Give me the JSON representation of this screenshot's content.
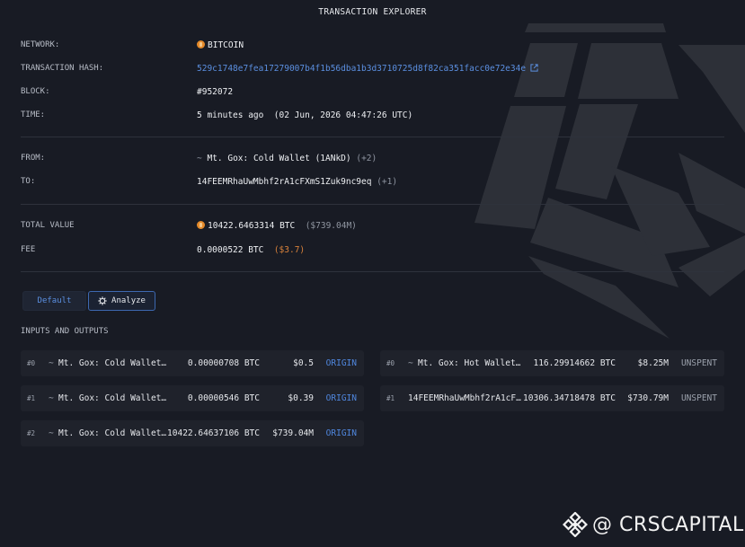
{
  "title": "TRANSACTION EXPLORER",
  "details": {
    "network_label": "NETWORK:",
    "network_value": "BITCOIN",
    "hash_label": "TRANSACTION HASH:",
    "hash_value": "529c1748e7fea17279007b4f1b56dba1b3d3710725d8f82ca351facc0e72e34e",
    "block_label": "BLOCK:",
    "block_value": "#952072",
    "time_label": "TIME:",
    "time_value": "5 minutes ago  (02 Jun, 2026 04:47:26 UTC)",
    "from_label": "FROM:",
    "from_value": "Mt. Gox: Cold Wallet (1ANkD)",
    "from_extra": "(+2)",
    "to_label": "TO:",
    "to_value": "14FEEMRhaUwMbhf2rA1cFXmS1Zuk9nc9eq",
    "to_extra": "(+1)",
    "total_label": "TOTAL VALUE",
    "total_value": "10422.6463314 BTC",
    "total_usd": "($739.04M)",
    "fee_label": "FEE",
    "fee_value": "0.0000522 BTC",
    "fee_usd": "($3.7)"
  },
  "tabs": {
    "default_label": "Default",
    "analyze_label": "Analyze"
  },
  "io_section_label": "INPUTS AND OUTPUTS",
  "inputs": [
    {
      "index": "#0",
      "name": "Mt. Gox: Cold Wallet…",
      "amount": "0.00000708 BTC",
      "usd": "$0.5",
      "tag": "ORIGIN"
    },
    {
      "index": "#1",
      "name": "Mt. Gox: Cold Wallet…",
      "amount": "0.00000546 BTC",
      "usd": "$0.39",
      "tag": "ORIGIN"
    },
    {
      "index": "#2",
      "name": "Mt. Gox: Cold Wallet…",
      "amount": "10422.64637106 BTC",
      "usd": "$739.04M",
      "tag": "ORIGIN"
    }
  ],
  "outputs": [
    {
      "index": "#0",
      "name": "Mt. Gox: Hot Wallet…",
      "amount": "116.29914662 BTC",
      "usd": "$8.25M",
      "tag": "UNSPENT"
    },
    {
      "index": "#1",
      "name": "14FEEMRhaUwMbhf2rA1cF…",
      "amount": "10306.34718478 BTC",
      "usd": "$730.79M",
      "tag": "UNSPENT"
    }
  ],
  "tilde_symbol": "~",
  "watermark": "@ CRSCAPITAL",
  "colors": {
    "background": "#181b24",
    "accent": "#5b8fe0",
    "bitcoin": "#e58a2a",
    "usd_note": "#d9823b"
  },
  "icons": {
    "network": "bitcoin-coin-icon",
    "hash": "external-link-icon",
    "analyze": "gear-icon",
    "watermark": "binance-logo-icon"
  }
}
